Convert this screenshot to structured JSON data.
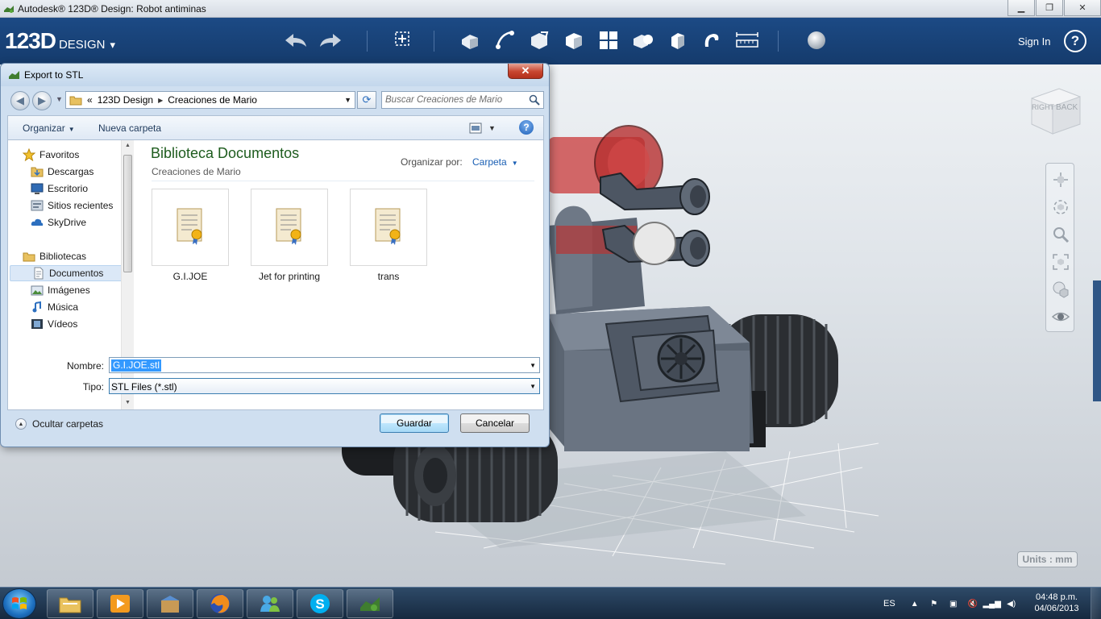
{
  "app": {
    "window_title": "Autodesk® 123D® Design: Robot antiminas",
    "logo_main": "123D",
    "logo_sub": "DESIGN",
    "sign_in": "Sign In",
    "help": "?",
    "units": "Units : mm",
    "toolbar_icons": [
      "undo-icon",
      "redo-icon",
      "transform-icon",
      "primitives-icon",
      "sketch-icon",
      "construct-icon",
      "modify-icon",
      "pattern-icon",
      "grouping-icon",
      "combine-icon",
      "measure-icon",
      "snap-icon",
      "ruler-icon",
      "material-icon"
    ],
    "nav_icons": [
      "pan-icon",
      "orbit-icon",
      "zoom-icon",
      "fit-icon",
      "material-display-icon",
      "eye-icon"
    ],
    "view_cube_faces": [
      "RIGHT",
      "BACK"
    ],
    "accent": "#1c4a85"
  },
  "dialog": {
    "title": "Export to STL",
    "close": "✕",
    "breadcrumb": [
      "«",
      "123D Design",
      "Creaciones de Mario"
    ],
    "search_placeholder": "Buscar Creaciones de Mario",
    "organize": "Organizar",
    "new_folder": "Nueva carpeta",
    "library_title": "Biblioteca Documentos",
    "library_sub": "Creaciones de Mario",
    "arrange_by_label": "Organizar por:",
    "arrange_by_value": "Carpeta",
    "tree": {
      "favorites": "Favoritos",
      "downloads": "Descargas",
      "desktop": "Escritorio",
      "recent": "Sitios recientes",
      "skydrive": "SkyDrive",
      "libraries": "Bibliotecas",
      "documents": "Documentos",
      "images": "Imágenes",
      "music": "Música",
      "videos": "Vídeos"
    },
    "files": [
      "G.I.JOE",
      "Jet for printing",
      "trans"
    ],
    "filename_label": "Nombre:",
    "filename_value": "G.I.JOE.stl",
    "type_label": "Tipo:",
    "type_value": "STL Files (*.stl)",
    "hide_folders": "Ocultar carpetas",
    "save": "Guardar",
    "cancel": "Cancelar"
  },
  "taskbar": {
    "apps": [
      "explorer-icon",
      "media-player-icon",
      "installer-icon",
      "firefox-icon",
      "messenger-icon",
      "skype-icon",
      "123d-design-icon"
    ],
    "language": "ES",
    "time": "04:48 p.m.",
    "date": "04/06/2013"
  }
}
